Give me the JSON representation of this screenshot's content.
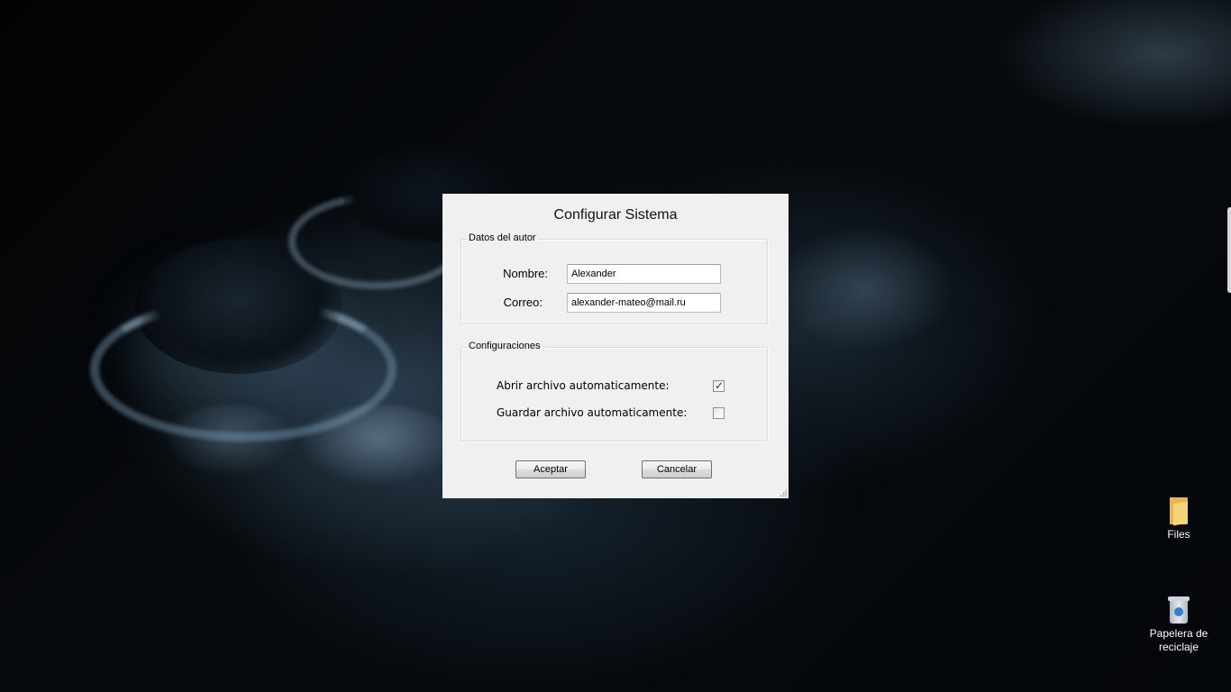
{
  "desktop": {
    "icons": [
      {
        "label": "Files",
        "icon": "folder-icon"
      },
      {
        "label": "Papelera de reciclaje",
        "icon": "recycle-bin-icon"
      }
    ]
  },
  "dialog": {
    "title": "Configurar Sistema",
    "author_group": {
      "legend": "Datos del autor",
      "name_label": "Nombre:",
      "name_value": "Alexander",
      "email_label": "Correo:",
      "email_value": "alexander-mateo@mail.ru"
    },
    "config_group": {
      "legend": "Configuraciones",
      "open_auto_label": "Abrir archivo automaticamente:",
      "open_auto_checked": true,
      "save_auto_label": "Guardar archivo automaticamente:",
      "save_auto_checked": false
    },
    "buttons": {
      "accept": "Aceptar",
      "cancel": "Cancelar"
    }
  },
  "colors": {
    "dialog_bg": "#f0f0f0",
    "checkmark": "#21376b",
    "desktop_bg": "#05080b"
  }
}
